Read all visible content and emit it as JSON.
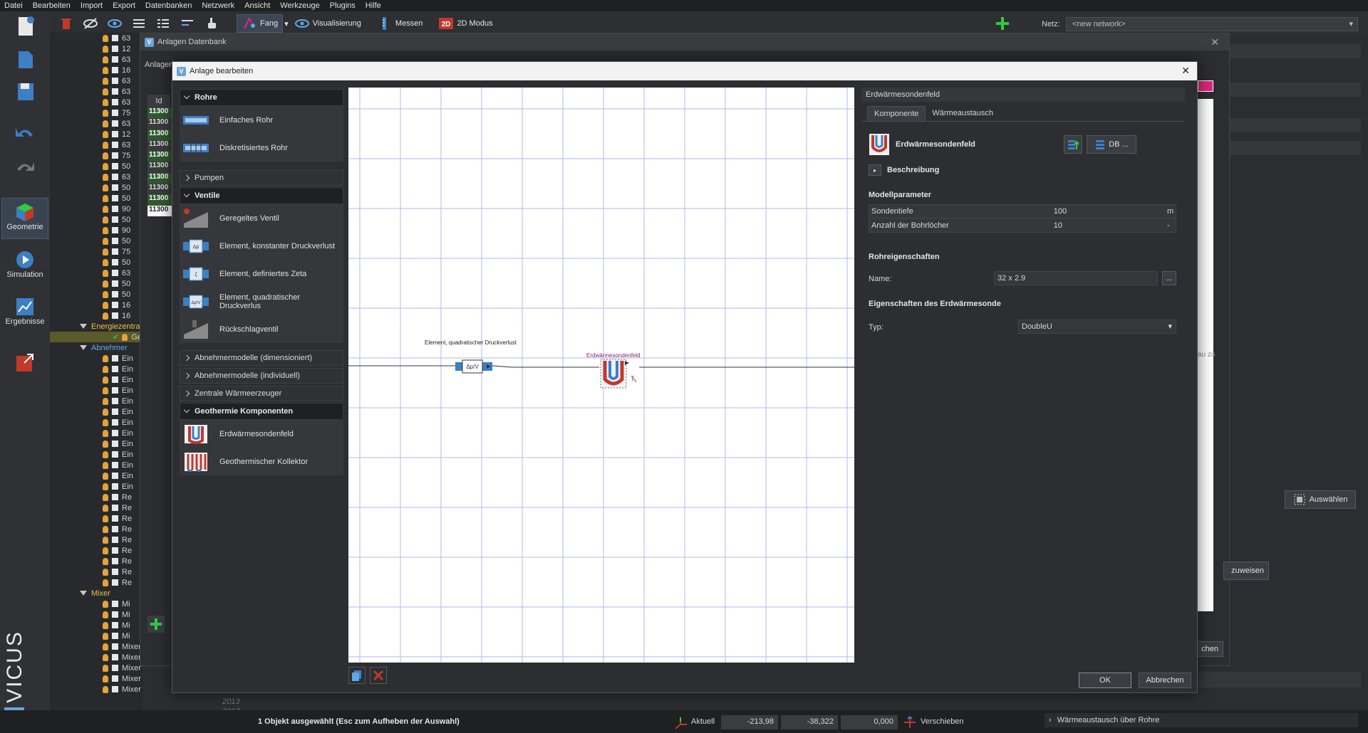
{
  "menu": [
    "Datei",
    "Bearbeiten",
    "Import",
    "Export",
    "Datenbanken",
    "Netzwerk",
    "Ansicht",
    "Werkzeuge",
    "Plugins",
    "Hilfe"
  ],
  "toolbar": {
    "fang": "Fang",
    "visualisierung": "Visualisierung",
    "messen": "Messen",
    "modus_2d": "2D Modus",
    "netz_label": "Netz:",
    "netz_value": "<new network>"
  },
  "sidebar": {
    "geometrie": "Geometrie",
    "simulation": "Simulation",
    "ergebnisse": "Ergebnisse",
    "brand": "VICUS"
  },
  "tree": {
    "numbers": [
      "63",
      "12",
      "63",
      "16",
      "63",
      "63",
      "63",
      "75",
      "63",
      "12",
      "63",
      "75",
      "50",
      "63",
      "50",
      "50",
      "90",
      "50",
      "90",
      "50",
      "75",
      "50",
      "63",
      "50",
      "50",
      "16",
      "16"
    ],
    "group_energy": "Energiezentra",
    "energy_child": "Ge",
    "group_abnehmer": "Abnehmer",
    "abnehmer_items": [
      "Ein",
      "Ein",
      "Ein",
      "Ein",
      "Ein",
      "Ein",
      "Ein",
      "Ein",
      "Ein",
      "Ein",
      "Ein",
      "Ein",
      "Ein",
      "Re",
      "Re",
      "Re",
      "Re",
      "Re",
      "Re",
      "Re",
      "Re",
      "Re"
    ],
    "group_mixer": "Mixer",
    "mixer_items": [
      "Mi",
      "Mi",
      "Mi",
      "Mi",
      "Mixer",
      "Mixer",
      "Mixer",
      "Mixer",
      "Mixer"
    ],
    "years": [
      "2013",
      "2017"
    ]
  },
  "outer_dialog": {
    "title": "Anlagen Datenbank",
    "left_label": "Anlagen",
    "id_header": "Id",
    "ids": [
      "11300",
      "11300",
      "11300",
      "11300",
      "11300",
      "11300",
      "11300",
      "11300",
      "11300",
      "11300"
    ],
    "btn_zuweisen": "zuweisen",
    "btn_auswaehlen": "Auswählen",
    "btn_schliessen": "chen",
    "side_text": "au zu"
  },
  "dialog": {
    "title": "Anlage bearbeiten",
    "ok": "OK",
    "cancel": "Abbrechen"
  },
  "palette": {
    "rohre": "Rohre",
    "rohre_items": [
      "Einfaches Rohr",
      "Diskretisiertes Rohr"
    ],
    "pumpen": "Pumpen",
    "ventile": "Ventile",
    "ventile_items": [
      "Geregeltes Ventil",
      "Element, konstanter Druckverlust",
      "Element, definiertes Zeta",
      "Element, quadratischer Druckverlus",
      "Rückschlagventil"
    ],
    "abnehmer_dim": "Abnehmermodelle (dimensioniert)",
    "abnehmer_ind": "Abnehmermodelle (individuell)",
    "zentrale": "Zentrale Wärmeerzeuger",
    "geothermie": "Geothermie Komponenten",
    "geothermie_items": [
      "Erdwärmesondenfeld",
      "Geothermischer Kollektor"
    ]
  },
  "canvas": {
    "label_element": "Element, quadratischer Druckverlust",
    "label_erdwaerme": "Erdwärmesondenfeld",
    "dp_symbol": "Δp/V"
  },
  "props": {
    "header": "Erdwärmesondenfeld",
    "tab_komponente": "Komponente",
    "tab_waermeaustausch": "Wärmeaustausch",
    "component_name": "Erdwärmesondenfeld",
    "db_button": "DB ...",
    "beschreibung": "Beschreibung",
    "modellparameter": "Modellparameter",
    "params": [
      {
        "name": "Sondentiefe",
        "value": "100",
        "unit": "m"
      },
      {
        "name": "Anzahl der Bohrlöcher",
        "value": "10",
        "unit": "-"
      }
    ],
    "rohreigenschaften": "Rohreigenschaften",
    "name_label": "Name:",
    "name_value": "32 x 2.9",
    "more_btn": "...",
    "eigenschaften": "Eigenschaften des Erdwärmesonde",
    "typ_label": "Typ:",
    "typ_value": "DoubleU"
  },
  "status": {
    "message": "1 Objekt ausgewählt (Esc zum Aufheben der Auswahl)",
    "aktuell": "Aktuell",
    "x": "-213,98",
    "y": "-38,322",
    "z": "0,000",
    "verschieben": "Verschieben",
    "waermeaustausch": "Wärmeaustausch über Rohre"
  },
  "colors": {
    "accent_blue": "#3d7fc4",
    "geo_red": "#c0392b",
    "pink": "#e0267a",
    "grid": "#b7b5f0"
  }
}
